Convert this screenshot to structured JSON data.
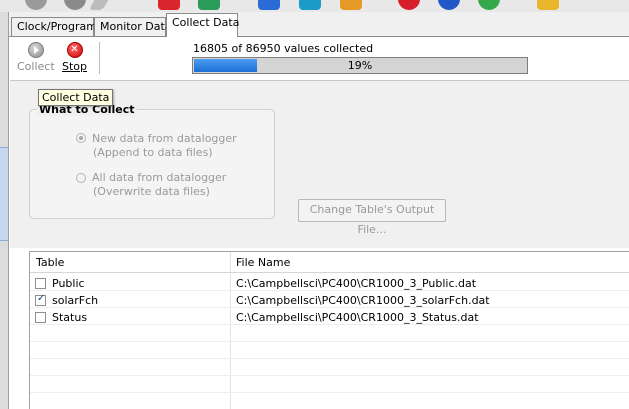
{
  "tabs": [
    {
      "label": "Clock/Program"
    },
    {
      "label": "Monitor Data"
    },
    {
      "label": "Collect Data"
    }
  ],
  "toolbar": {
    "collect_label": "Collect",
    "stop_label": "Stop",
    "tooltip": "Collect Data"
  },
  "progress": {
    "text": "16805 of 86950 values collected",
    "label": "19%",
    "fraction": 0.19
  },
  "what_to_collect": {
    "title": "What to Collect",
    "options": [
      {
        "label": "New data from datalogger",
        "sub": "(Append to data files)",
        "selected": true
      },
      {
        "label": "All data from datalogger",
        "sub": "(Overwrite data files)",
        "selected": false
      }
    ]
  },
  "change_button_label": "Change Table's Output File...",
  "table": {
    "headers": [
      "Table",
      "File Name"
    ],
    "rows": [
      {
        "name": "Public",
        "file": "C:\\Campbellsci\\PC400\\CR1000_3_Public.dat",
        "checked": false
      },
      {
        "name": "solarFch",
        "file": "C:\\Campbellsci\\PC400\\CR1000_3_solarFch.dat",
        "checked": true
      },
      {
        "name": "Status",
        "file": "C:\\Campbellsci\\PC400\\CR1000_3_Status.dat",
        "checked": false
      }
    ]
  }
}
